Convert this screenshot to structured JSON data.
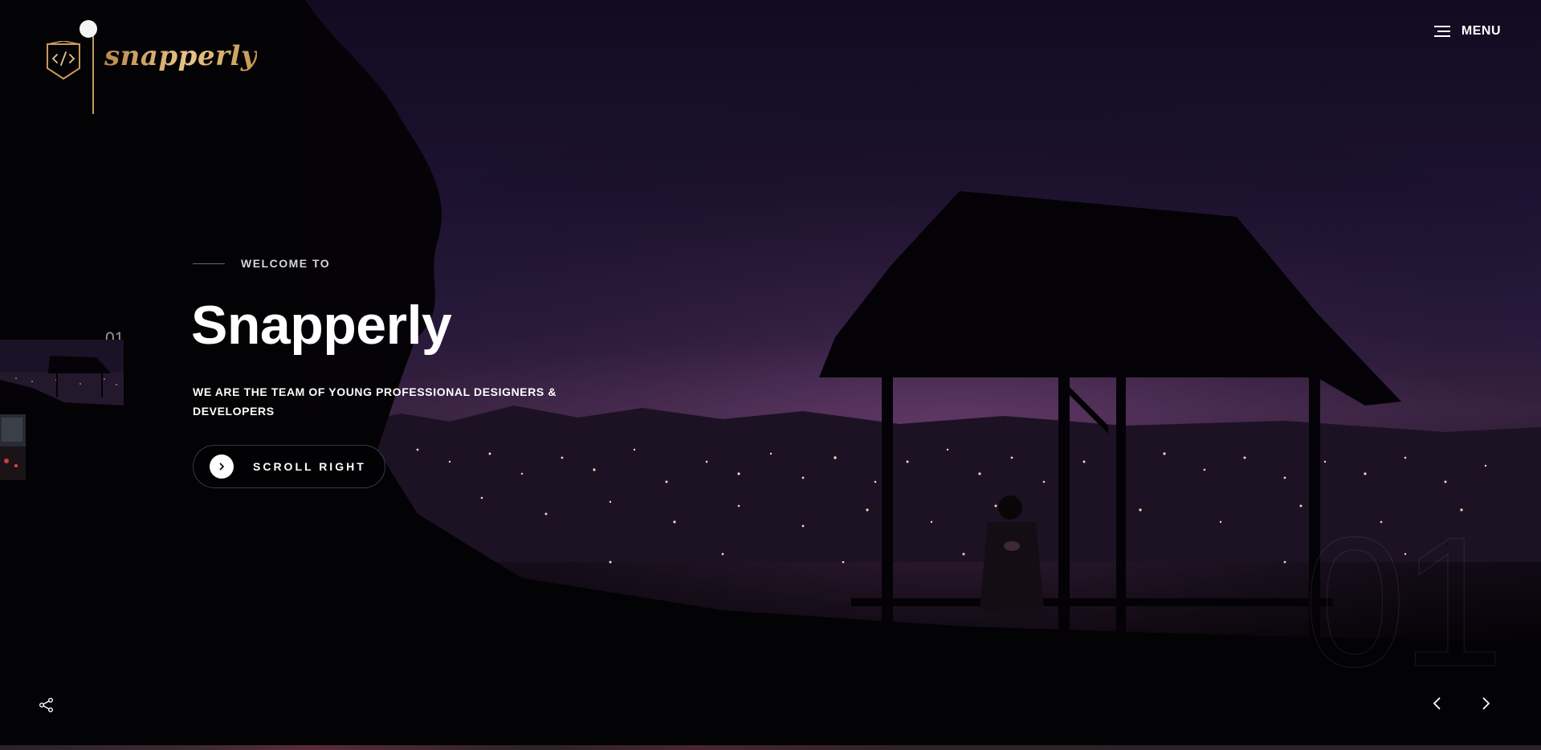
{
  "brand": {
    "logo_text": "snapperly",
    "logo_icon": "code-brackets-icon"
  },
  "header": {
    "menu_label": "MENU",
    "menu_icon": "hamburger-icon"
  },
  "hero": {
    "eyebrow": "WELCOME TO",
    "title": "Snapperly",
    "subtitle": "WE ARE THE TEAM OF YOUNG PROFESSIONAL DESIGNERS & DEVELOPERS",
    "cta_label": "SCROLL RIGHT",
    "cta_icon": "chevron-right-icon"
  },
  "slider": {
    "current_index_label": "01",
    "big_number": "01",
    "thumbnails": [
      {
        "name": "night-city-gazebo"
      },
      {
        "name": "city-lights"
      }
    ],
    "prev_icon": "chevron-left-icon",
    "next_icon": "chevron-right-icon"
  },
  "footer": {
    "share_icon": "share-icon"
  },
  "colors": {
    "accent_gold": "#c89a5c",
    "text": "#ffffff",
    "muted": "#9a94a2"
  }
}
